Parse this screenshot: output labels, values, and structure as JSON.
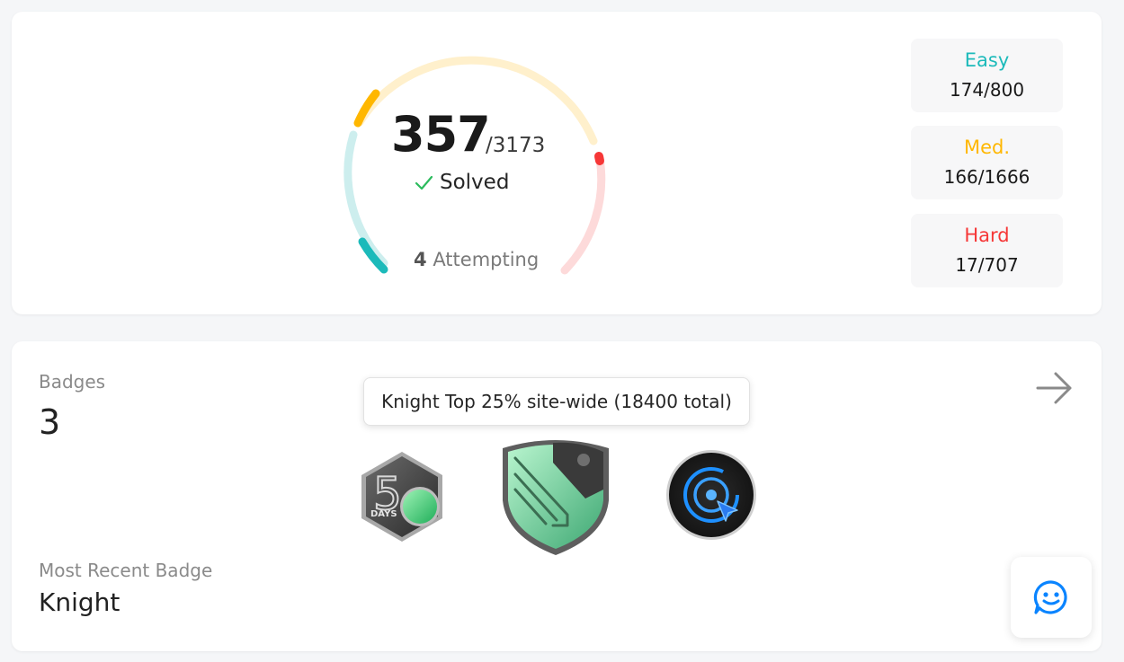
{
  "progress": {
    "solved_count": "357",
    "total_count": "/3173",
    "solved_label": "Solved",
    "attempting_count": "4",
    "attempting_label": "Attempting",
    "difficulty": [
      {
        "label": "Easy",
        "value": "174/800",
        "color": "#1cbaba",
        "solved": 174,
        "total": 800
      },
      {
        "label": "Med.",
        "value": "166/1666",
        "color": "#ffb700",
        "solved": 166,
        "total": 1666
      },
      {
        "label": "Hard",
        "value": "17/707",
        "color": "#f63737",
        "solved": 17,
        "total": 707
      }
    ]
  },
  "badges": {
    "title": "Badges",
    "count": "3",
    "tooltip": "Knight Top 25% site-wide (18400 total)",
    "badge_days_text": "DAYS",
    "recent_label": "Most Recent Badge",
    "recent_name": "Knight"
  },
  "icons": {
    "arrow": "arrow-right-icon",
    "chat": "smiley-chat-icon",
    "check": "check-icon"
  }
}
